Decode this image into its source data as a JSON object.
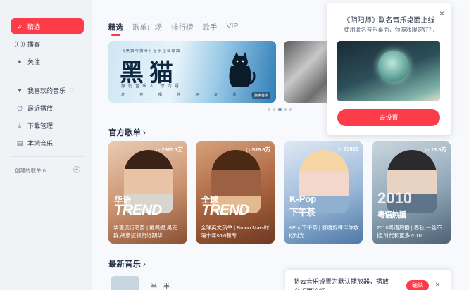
{
  "sidebar": {
    "items": [
      {
        "label": "精选",
        "icon": "music-note-icon"
      },
      {
        "label": "播客",
        "icon": "podcast-icon"
      },
      {
        "label": "关注",
        "icon": "chat-icon"
      },
      {
        "label": "我喜欢的音乐",
        "icon": "heart-icon"
      },
      {
        "label": "最近播放",
        "icon": "clock-icon"
      },
      {
        "label": "下载管理",
        "icon": "download-icon"
      },
      {
        "label": "本地音乐",
        "icon": "folder-icon"
      }
    ],
    "created_playlists": "创建的歌单 0"
  },
  "tabs": [
    "精选",
    "歌单广场",
    "排行榜",
    "歌手",
    "VIP"
  ],
  "banner": {
    "small_text": "《黑猫与猫爷》音乐企业歌曲",
    "big_text": "黑猫",
    "sub_text": "原创音乐人 徐均朔",
    "line_text": "灯 夜 相 伴 好 友 伐 依",
    "tag": "独家首发"
  },
  "sections": {
    "official_playlists": "官方歌单",
    "new_music": "最新音乐"
  },
  "playlists": [
    {
      "count": "2575.7万",
      "title1": "华语",
      "title2": "TREND",
      "desc": "华语流行趋势 | 戴佩妮,吴克群,胡彦斌领衔近期华..."
    },
    {
      "count": "535.6万",
      "title1": "全球",
      "title2": "TREND",
      "desc": "全球英文热单 | Bruno Mars时隔十年solo新专..."
    },
    {
      "count": "89021",
      "title1": "K-Pop",
      "title2": "下午茶",
      "desc": "KPop下午茶 | 舒缓旋律伴你放松时光"
    },
    {
      "count": "13.5万",
      "title1": "2010",
      "title2": "粤语热播",
      "desc": "2010粤语热播 | 春秋,一丝不挂,时代和更多2010..."
    }
  ],
  "new_song": {
    "name": "一半一半"
  },
  "popup": {
    "title": "《阴阳师》联名音乐桌面上线",
    "subtitle": "使用联名音乐桌面，领游戏限定好礼",
    "button": "去设置",
    "close": "×"
  },
  "toast": {
    "text": "将云音乐设置为默认播放器，播放音乐更流畅",
    "confirm": "确认",
    "close": "×"
  },
  "colors": {
    "accent": "#fc3d49"
  }
}
